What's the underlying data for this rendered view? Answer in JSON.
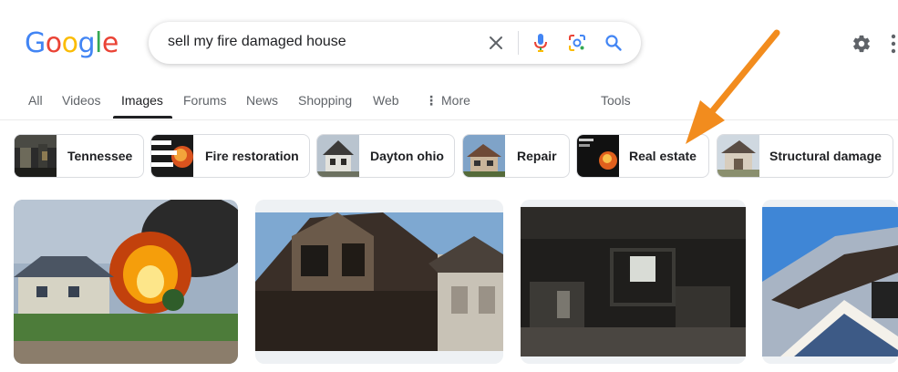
{
  "logo": {
    "letters": [
      "G",
      "o",
      "o",
      "g",
      "l",
      "e"
    ],
    "colors": [
      "#4285F4",
      "#EA4335",
      "#FBBC05",
      "#4285F4",
      "#34A853",
      "#EA4335"
    ]
  },
  "search": {
    "query": "sell my fire damaged house",
    "icons": [
      "close-icon",
      "mic-icon",
      "lens-icon",
      "search-icon"
    ]
  },
  "header": {
    "settings_icon": "gear-icon",
    "apps_icon": "apps-grid-icon"
  },
  "tabs": {
    "items": [
      "All",
      "Videos",
      "Images",
      "Forums",
      "News",
      "Shopping",
      "Web"
    ],
    "more": "More",
    "tools": "Tools",
    "active": "Images"
  },
  "chips": [
    {
      "label": "Tennessee"
    },
    {
      "label": "Fire restoration"
    },
    {
      "label": "Dayton ohio"
    },
    {
      "label": "Repair"
    },
    {
      "label": "Real estate"
    },
    {
      "label": "Structural damage"
    }
  ],
  "colors": {
    "accent_arrow": "#F28C1E",
    "text": "#202124",
    "muted": "#5f6368",
    "blue": "#1a73e8"
  }
}
